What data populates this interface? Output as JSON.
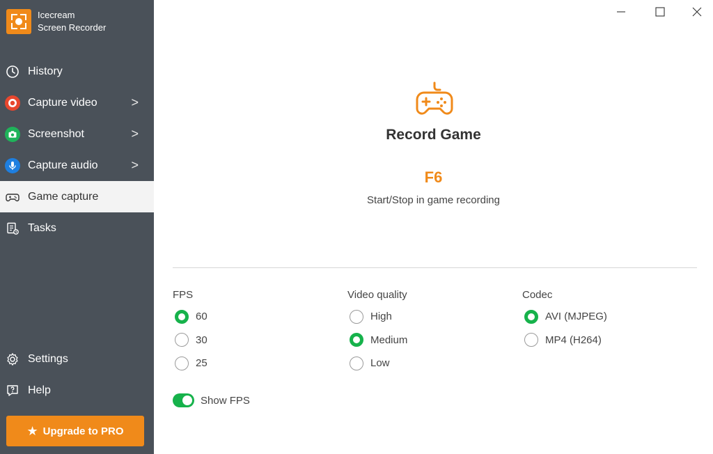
{
  "app": {
    "name_line1": "Icecream",
    "name_line2": "Screen Recorder"
  },
  "sidebar": {
    "items": [
      {
        "label": "History",
        "icon": "clock-icon"
      },
      {
        "label": "Capture video",
        "icon": "record-icon",
        "chevron": ">"
      },
      {
        "label": "Screenshot",
        "icon": "camera-icon",
        "chevron": ">"
      },
      {
        "label": "Capture audio",
        "icon": "microphone-icon",
        "chevron": ">"
      },
      {
        "label": "Game capture",
        "icon": "gamepad-icon",
        "active": true
      },
      {
        "label": "Tasks",
        "icon": "tasks-icon"
      }
    ],
    "bottom_items": [
      {
        "label": "Settings",
        "icon": "gear-icon"
      },
      {
        "label": "Help",
        "icon": "help-icon"
      }
    ],
    "upgrade_label": "Upgrade to PRO"
  },
  "main": {
    "title": "Record Game",
    "hotkey": "F6",
    "hotkey_desc": "Start/Stop in game recording",
    "fps": {
      "title": "FPS",
      "options": [
        "60",
        "30",
        "25"
      ],
      "selected": "60"
    },
    "quality": {
      "title": "Video quality",
      "options": [
        "High",
        "Medium",
        "Low"
      ],
      "selected": "Medium"
    },
    "codec": {
      "title": "Codec",
      "options": [
        "AVI (MJPEG)",
        "MP4 (H264)"
      ],
      "selected": "AVI (MJPEG)"
    },
    "show_fps": {
      "label": "Show FPS",
      "enabled": true
    }
  },
  "colors": {
    "accent": "#f08a1a",
    "sidebar": "#4a5159",
    "green": "#16b24b"
  }
}
